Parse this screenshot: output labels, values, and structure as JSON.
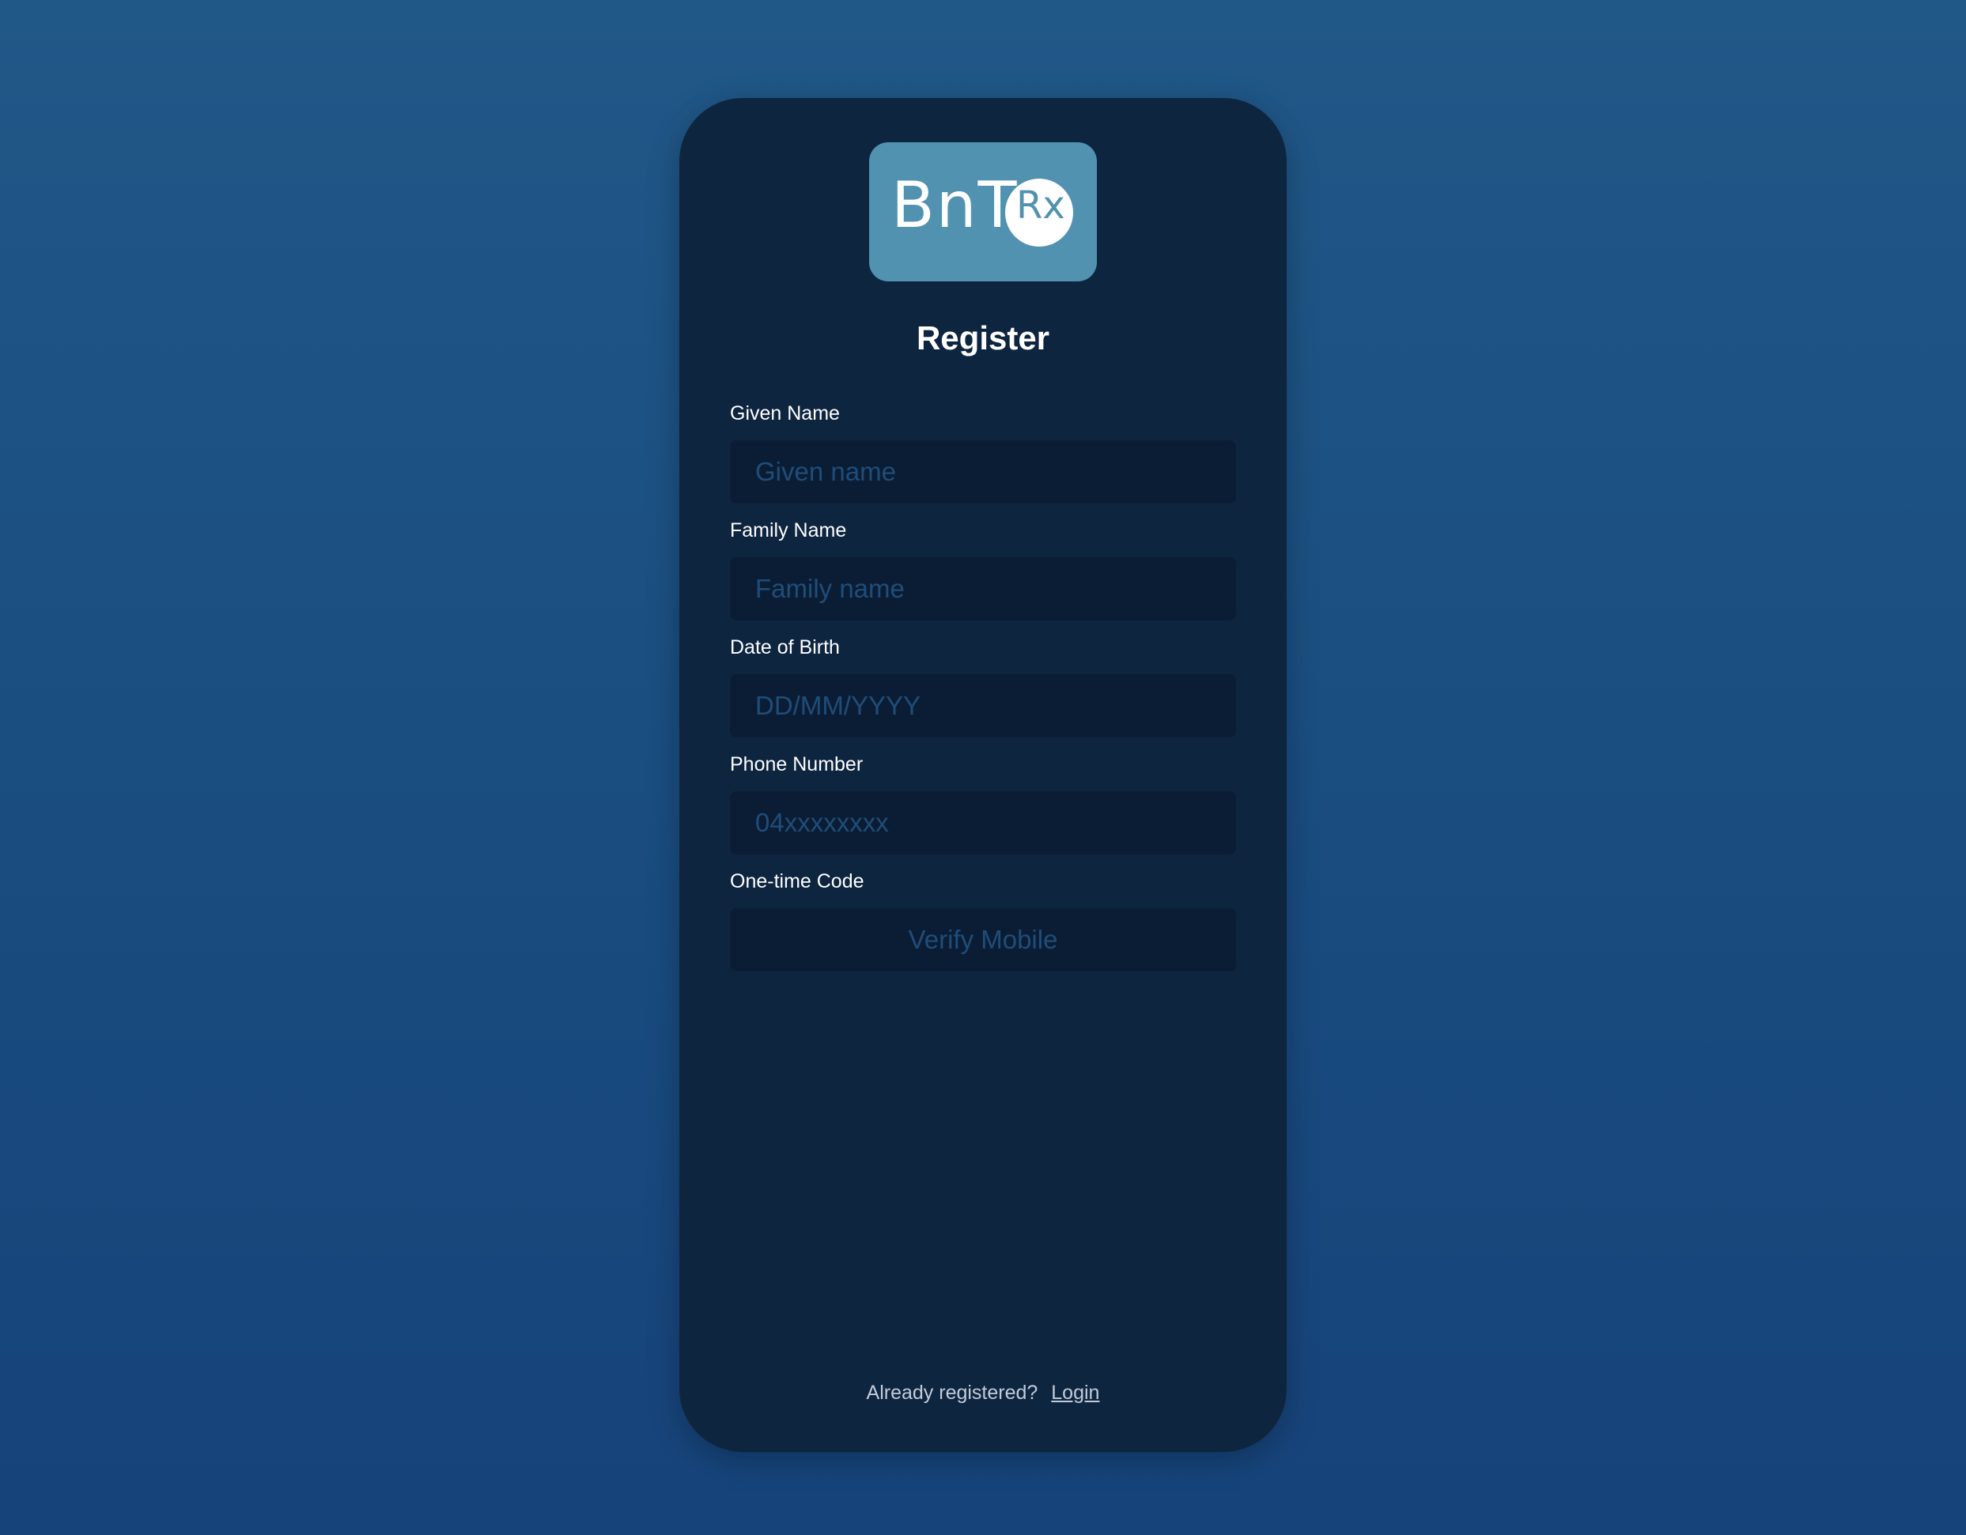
{
  "logo": {
    "text": "BnT",
    "badge_text": "Rx"
  },
  "title": "Register",
  "fields": {
    "given_name": {
      "label": "Given Name",
      "placeholder": "Given name"
    },
    "family_name": {
      "label": "Family Name",
      "placeholder": "Family name"
    },
    "dob": {
      "label": "Date of Birth",
      "placeholder": "DD/MM/YYYY"
    },
    "phone": {
      "label": "Phone Number",
      "placeholder": "04xxxxxxxx"
    },
    "otp": {
      "label": "One-time Code",
      "button_label": "Verify Mobile"
    }
  },
  "footer": {
    "prompt": "Already registered?",
    "login_label": "Login"
  },
  "colors": {
    "background": "#1a4d80",
    "card": "#0e2540",
    "logo": "#5192b0",
    "input": "#0b1d34",
    "placeholder": "#1f4d7a"
  }
}
